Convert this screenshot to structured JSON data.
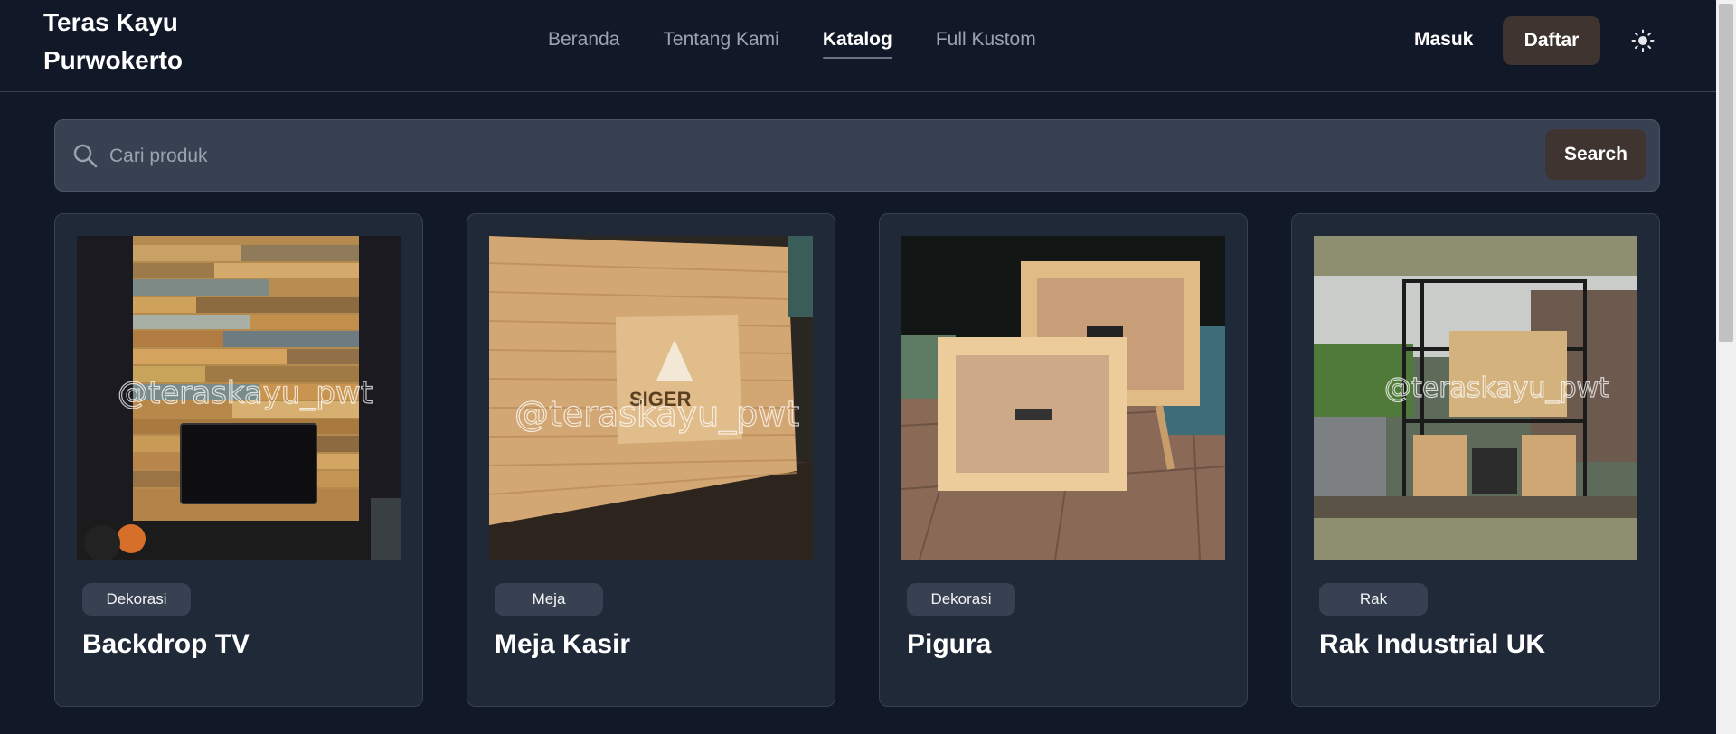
{
  "brand": {
    "line1": "Teras Kayu",
    "line2": "Purwokerto"
  },
  "nav": [
    {
      "label": "Beranda",
      "active": false
    },
    {
      "label": "Tentang Kami",
      "active": false
    },
    {
      "label": "Katalog",
      "active": true
    },
    {
      "label": "Full Kustom",
      "active": false
    }
  ],
  "auth": {
    "login_label": "Masuk",
    "register_label": "Daftar"
  },
  "theme_toggle": {
    "icon": "sun-icon"
  },
  "search": {
    "placeholder": "Cari produk",
    "value": "",
    "button_label": "Search",
    "icon": "search-icon"
  },
  "products": [
    {
      "category": "Dekorasi",
      "name": "Backdrop TV",
      "watermark": "@teraskayu_pwt"
    },
    {
      "category": "Meja",
      "name": "Meja Kasir",
      "watermark": "@teraskayu_pwt"
    },
    {
      "category": "Dekorasi",
      "name": "Pigura",
      "watermark": ""
    },
    {
      "category": "Rak",
      "name": "Rak Industrial UK",
      "watermark": "@teraskayu_pwt"
    }
  ],
  "colors": {
    "background": "#111827",
    "card": "#1f2937",
    "search_bg": "#374151",
    "accent_button": "#3f3430"
  }
}
